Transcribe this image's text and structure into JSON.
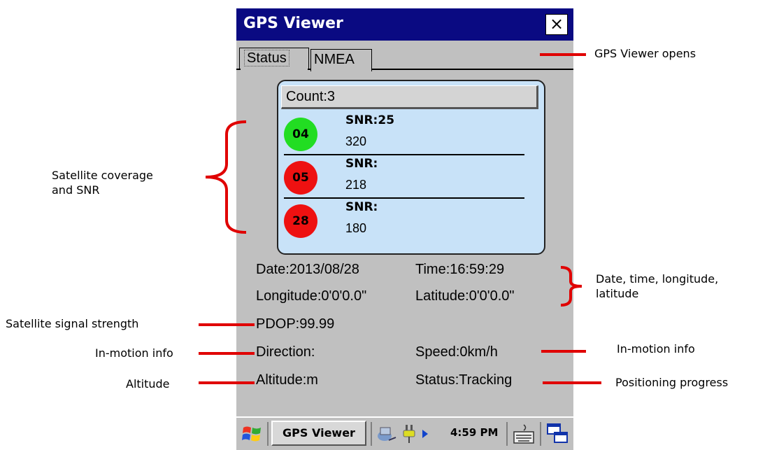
{
  "window": {
    "title": "GPS Viewer",
    "close_label": "×"
  },
  "tabs": [
    {
      "label": "Status",
      "selected": true
    },
    {
      "label": "NMEA",
      "selected": false
    }
  ],
  "satellites": {
    "count_label": "Count:3",
    "items": [
      {
        "id": "04",
        "snr": "SNR:25",
        "value": "320",
        "color": "#22dd22"
      },
      {
        "id": "05",
        "snr": "SNR:",
        "value": "218",
        "color": "#ee1111"
      },
      {
        "id": "28",
        "snr": "SNR:",
        "value": "180",
        "color": "#ee1111"
      }
    ]
  },
  "info": {
    "date": "Date:2013/08/28",
    "time": "Time:16:59:29",
    "longitude": "Longitude:0'0'0.0\"",
    "latitude": "Latitude:0'0'0.0\"",
    "pdop": "PDOP:99.99",
    "direction": "Direction:",
    "speed": "Speed:0km/h",
    "altitude": "Altitude:m",
    "status": "Status:Tracking"
  },
  "taskbar": {
    "task_label": "GPS Viewer",
    "clock": "4:59 PM",
    "icons": [
      "windows-start-icon",
      "network-icon",
      "power-plug-icon",
      "keyboard-icon",
      "switch-window-icon"
    ]
  },
  "annotations": {
    "gps_viewer_opens": "GPS Viewer opens",
    "satellite_coverage_line1": "Satellite coverage",
    "satellite_coverage_line2": "and SNR",
    "datetime_line1": "Date, time, longitude,",
    "datetime_line2": "latitude",
    "signal_strength": "Satellite signal strength",
    "inmotion_left": "In-motion info",
    "inmotion_right": "In-motion info",
    "altitude": "Altitude",
    "positioning": "Positioning progress"
  },
  "colors": {
    "titlebar": "#0a0a82",
    "panel": "#c8e2f8",
    "annotation_red": "#e00000",
    "device_gray": "#c0c0c0"
  }
}
